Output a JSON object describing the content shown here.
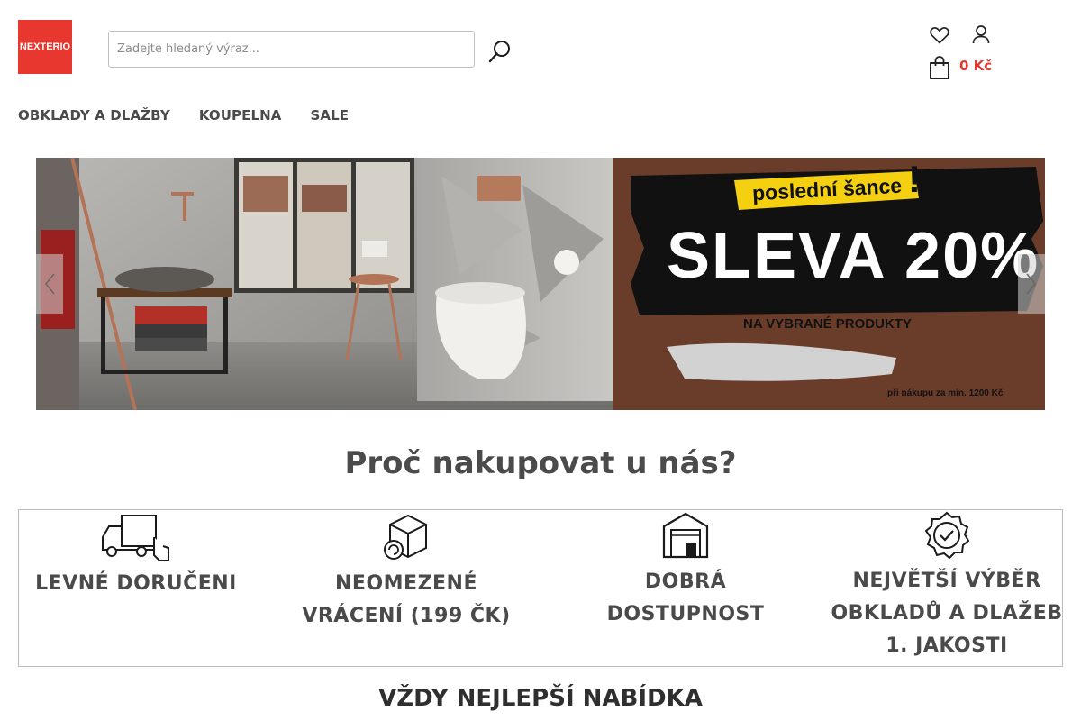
{
  "header": {
    "logo_text": "NEXTERIO",
    "brand_color": "#e8372e",
    "search": {
      "placeholder": "Zadejte hledaný výraz...",
      "value": "",
      "icon": "search-icon"
    },
    "wishlist_icon": "heart-icon",
    "account_icon": "user-icon",
    "cart": {
      "icon": "shopping-bag-icon",
      "total": "0 Kč",
      "total_color": "#e23a31"
    }
  },
  "nav": {
    "items": [
      {
        "label": "OBKLADY A DLAŽBY"
      },
      {
        "label": "KOUPELNA"
      },
      {
        "label": "SALE"
      }
    ]
  },
  "banner": {
    "tag": "poslední šance",
    "headline": "SLEVA 20%",
    "subline": "NA VYBRANÉ PRODUKTY",
    "note": "při nákupu za min. 1200 Kč",
    "prev_icon": "chevron-left-icon",
    "next_icon": "chevron-right-icon"
  },
  "why": {
    "title": "Proč nakupovat u nás?",
    "features": [
      {
        "icon": "delivery-truck-icon",
        "label": "LEVNÉ DORUČENI"
      },
      {
        "icon": "package-return-icon",
        "label": "NEOMEZENÉ VRÁCENÍ (199 ČK)"
      },
      {
        "icon": "warehouse-icon",
        "label": "DOBRÁ DOSTUPNOST"
      },
      {
        "icon": "quality-badge-icon",
        "label": "NEJVĚTŠÍ VÝBĚR OBKLADŮ A DLAŽEB 1. JAKOSTI"
      }
    ]
  },
  "offer": {
    "title": "VŽDY NEJLEPŠÍ NABÍDKA"
  }
}
